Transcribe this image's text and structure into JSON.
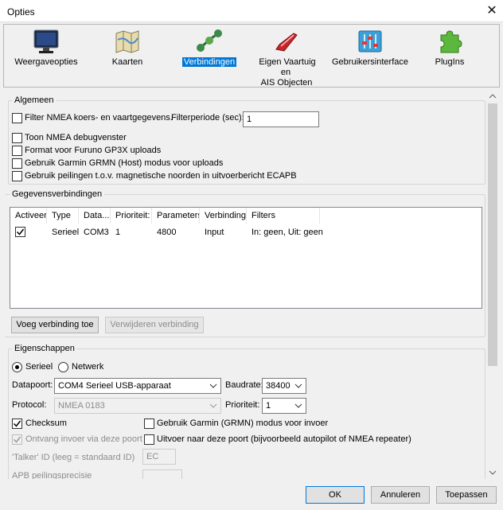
{
  "window": {
    "title": "Opties"
  },
  "toolbar": {
    "items": [
      {
        "label": "Weergaveopties"
      },
      {
        "label": "Kaarten"
      },
      {
        "label": "Verbindingen"
      },
      {
        "label": "Eigen Vaartuig en",
        "label2": "AIS Objecten"
      },
      {
        "label": "Gebruikersinterface"
      },
      {
        "label": "PlugIns"
      }
    ]
  },
  "algemeen": {
    "title": "Algemeen",
    "filter_nmea": "Filter NMEA koers- en vaartgegevens.",
    "filterperiode_label": "Filterperiode (sec):",
    "filterperiode_value": "1",
    "toon_debug": "Toon NMEA debugvenster",
    "furuno": "Format voor Furuno GP3X uploads",
    "garmin_host": "Gebruik Garmin GRMN (Host) modus voor uploads",
    "peilingen": "Gebruik peilingen t.o.v. magnetische noorden in uitvoerbericht ECAPB"
  },
  "gegevens": {
    "title": "Gegevensverbindingen",
    "columns": [
      "Activeer",
      "Type",
      "Data...",
      "Prioriteit:",
      "Parameters",
      "Verbinding",
      "Filters"
    ],
    "rows": [
      {
        "checked": true,
        "type": "Serieel",
        "data": "COM3",
        "prioriteit": "1",
        "parameters": "4800",
        "verbinding": "Input",
        "filters": "In: geen, Uit: geen"
      }
    ],
    "add_button": "Voeg verbinding toe",
    "remove_button": "Verwijderen verbinding"
  },
  "eigenschappen": {
    "title": "Eigenschappen",
    "serieel": "Serieel",
    "netwerk": "Netwerk",
    "datapoort_label": "Datapoort:",
    "datapoort_value": "COM4 Serieel USB-apparaat",
    "baudrate_label": "Baudrate:",
    "baudrate_value": "38400",
    "protocol_label": "Protocol:",
    "protocol_value": "NMEA 0183",
    "prioriteit_label": "Prioriteit:",
    "prioriteit_value": "1",
    "checksum": "Checksum",
    "garmin_invoer": "Gebruik Garmin (GRMN) modus voor invoer",
    "ontvang": "Ontvang invoer via deze poort",
    "uitvoer": "Uitvoer naar deze poort (bijvoorbeeld autopilot of NMEA repeater)",
    "talker_label": "'Talker' ID (leeg = standaard ID)",
    "talker_value": "EC",
    "apb_label": "APB peilingsprecisie"
  },
  "buttons": {
    "ok": "OK",
    "annuleren": "Annuleren",
    "toepassen": "Toepassen"
  }
}
